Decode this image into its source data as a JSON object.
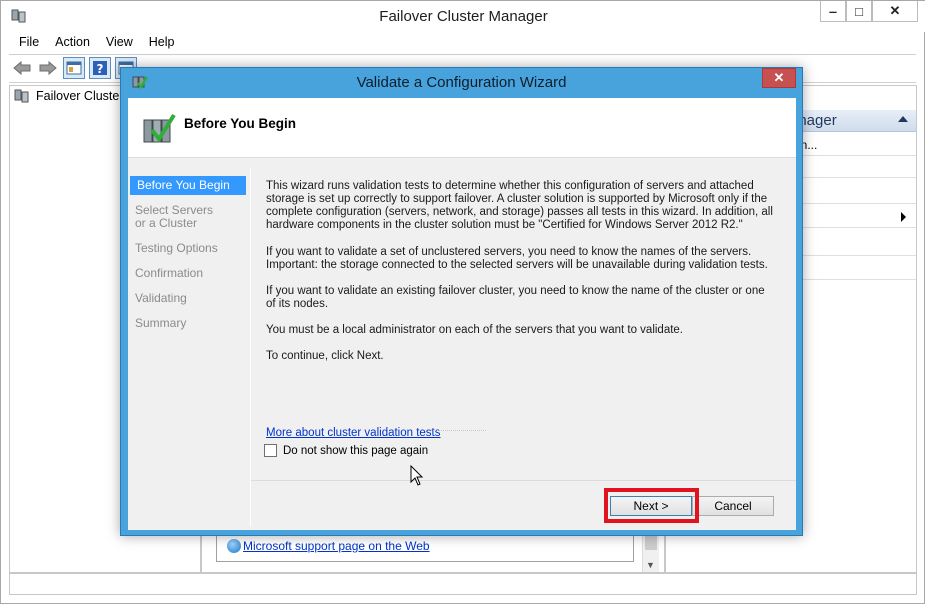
{
  "main_window": {
    "title": "Failover Cluster Manager",
    "controls": {
      "minimize": "‒",
      "maximize": "□",
      "close": "✕"
    },
    "menu": [
      "File",
      "Action",
      "View",
      "Help"
    ],
    "toolbar_icons": [
      "back-icon",
      "forward-icon",
      "console-tree-icon",
      "help-icon",
      "properties-icon"
    ],
    "tree": {
      "root_label": "Failover Cluster M"
    },
    "actions_pane": {
      "title": "anager",
      "rows": [
        "on...",
        "",
        "",
        "",
        "",
        ""
      ]
    },
    "support_link": "Microsoft support page on the Web"
  },
  "dialog": {
    "title": "Validate a Configuration Wizard",
    "close_label": "✕",
    "header_title": "Before You Begin",
    "steps": [
      {
        "label": "Before You Begin",
        "active": true
      },
      {
        "label": "Select Servers or a Cluster",
        "active": false
      },
      {
        "label": "Testing Options",
        "active": false
      },
      {
        "label": "Confirmation",
        "active": false
      },
      {
        "label": "Validating",
        "active": false
      },
      {
        "label": "Summary",
        "active": false
      }
    ],
    "paragraphs": [
      "This wizard runs validation tests to determine whether this configuration of servers and attached storage is set up correctly to support failover. A cluster solution is supported by Microsoft only if the complete configuration (servers, network, and storage) passes all tests in this wizard. In addition, all hardware components in the cluster solution must be \"Certified for Windows Server 2012 R2.\"",
      "If you want to validate a set of unclustered servers, you need to know the names of the servers. Important: the storage connected to the selected servers will be unavailable during validation tests.",
      "If you want to validate an existing failover cluster, you need to know the name of the cluster or one of its nodes.",
      "You must be a local administrator on each of the servers that you want to validate.",
      "To continue, click Next."
    ],
    "more_link": "More about cluster validation tests",
    "checkbox_label": "Do not show this page again",
    "checkbox_checked": false,
    "next_label": "Next >",
    "cancel_label": "Cancel"
  },
  "colors": {
    "dialog_frame": "#48a3dd",
    "active_step": "#3399ff",
    "link": "#0033cc",
    "highlight": "#e0141e",
    "close_button": "#c75050"
  }
}
